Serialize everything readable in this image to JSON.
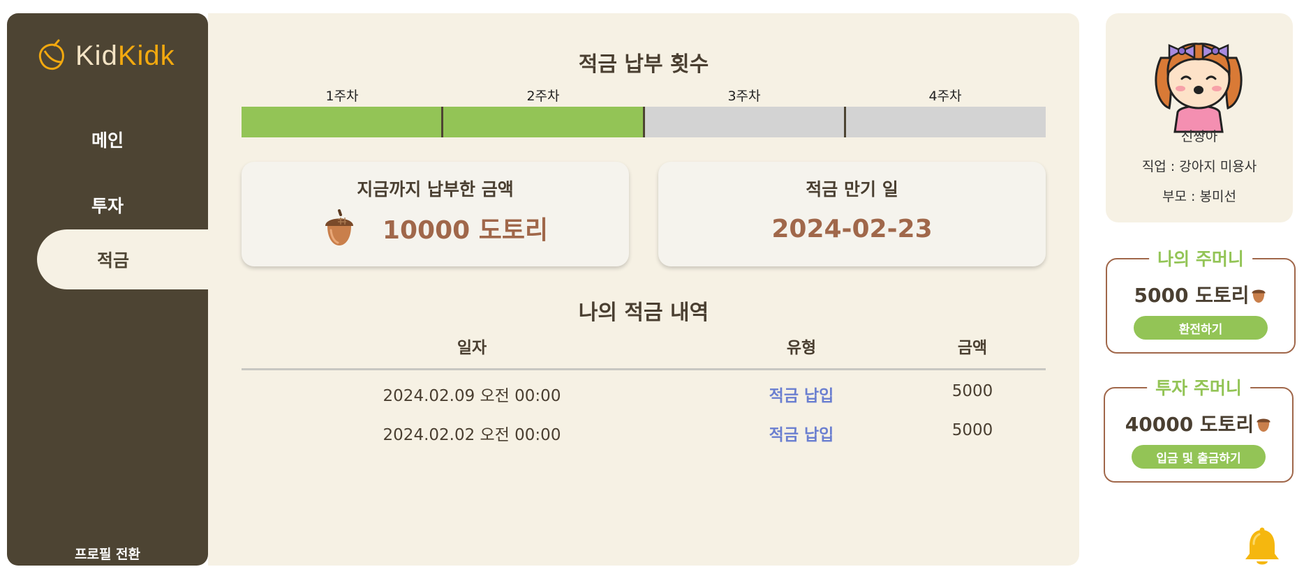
{
  "colors": {
    "sidebar_bg": "#4d4433",
    "main_bg": "#f6f1e4",
    "accent_green": "#93c456",
    "acorn_brown": "#a0674a",
    "link_blue": "#6b7fd0",
    "bell_yellow": "#f5b70f",
    "logo_yellow": "#f3a90f"
  },
  "brand": {
    "part1": "Kid",
    "part2": "Kidk",
    "icon": "acorn-logo-icon"
  },
  "sidebar": {
    "items": [
      {
        "label": "메인",
        "active": false
      },
      {
        "label": "투자",
        "active": false
      },
      {
        "label": "적금",
        "active": true
      }
    ],
    "profile_switch": "프로필 전환"
  },
  "savings": {
    "progress_title": "적금 납부 횟수",
    "weeks": [
      {
        "label": "1주차",
        "paid": true
      },
      {
        "label": "2주차",
        "paid": true
      },
      {
        "label": "3주차",
        "paid": false
      },
      {
        "label": "4주차",
        "paid": false
      }
    ],
    "paid_card": {
      "title": "지금까지 납부한 금액",
      "amount": "10000 도토리",
      "icon": "acorn-icon"
    },
    "maturity_card": {
      "title": "적금 만기 일",
      "date": "2024-02-23"
    },
    "history_title": "나의 적금 내역",
    "history_columns": [
      "일자",
      "유형",
      "금액"
    ],
    "history_rows": [
      {
        "date": "2024.02.09 오전 00:00",
        "type": "적금 납입",
        "amount": "5000"
      },
      {
        "date": "2024.02.02 오전 00:00",
        "type": "적금 납입",
        "amount": "5000"
      }
    ]
  },
  "profile": {
    "name": "신짱아",
    "job": "직업 : 강아지 미용사",
    "parent": "부모 : 봉미선",
    "avatar_icon": "girl-avatar-icon"
  },
  "wallets": [
    {
      "title": "나의 주머니",
      "amount": "5000 도토리",
      "button": "환전하기",
      "icon": "acorn-icon"
    },
    {
      "title": "투자 주머니",
      "amount": "40000 도토리",
      "button": "입금 및 출금하기",
      "icon": "acorn-icon"
    }
  ],
  "notification_icon": "bell-icon"
}
